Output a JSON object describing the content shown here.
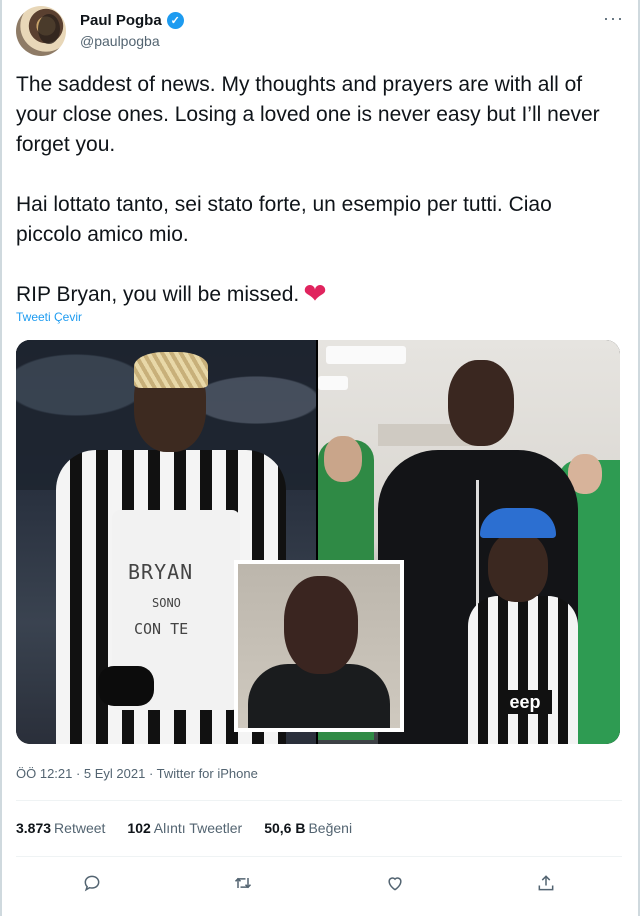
{
  "author": {
    "name": "Paul Pogba",
    "handle": "@paulpogba",
    "verified_mark": "✓"
  },
  "menu": {
    "more_label": "···"
  },
  "tweet": {
    "paragraphs": [
      "The saddest of news. My thoughts and prayers are with all of your close ones. Losing a loved one is never easy but I’ll never forget you.",
      "Hai lottato tanto, sei stato forte, un esempio per tutti. Ciao piccolo amico mio.",
      "RIP Bryan, you will be missed."
    ],
    "emoji": "❤",
    "translate_link": "Tweeti Çevir"
  },
  "media": {
    "shirt_text": [
      "BRYAN",
      "SONO",
      "CON TE"
    ],
    "boy_shirt_sponsor": "eep"
  },
  "meta": {
    "timestamp": "ÖÖ 12:21 · 5 Eyl 2021 · Twitter for iPhone"
  },
  "stats": {
    "retweets_count": "3.873",
    "retweets_label": "Retweet",
    "quotes_count": "102",
    "quotes_label": "Alıntı Tweetler",
    "likes_count": "50,6 B",
    "likes_label": "Beğeni"
  },
  "actions": [
    {
      "name": "reply-icon"
    },
    {
      "name": "retweet-icon"
    },
    {
      "name": "like-icon"
    },
    {
      "name": "share-icon"
    }
  ],
  "colors": {
    "accent": "#1d9bf0",
    "heart": "#e0245e",
    "secondary_text": "#536471"
  }
}
